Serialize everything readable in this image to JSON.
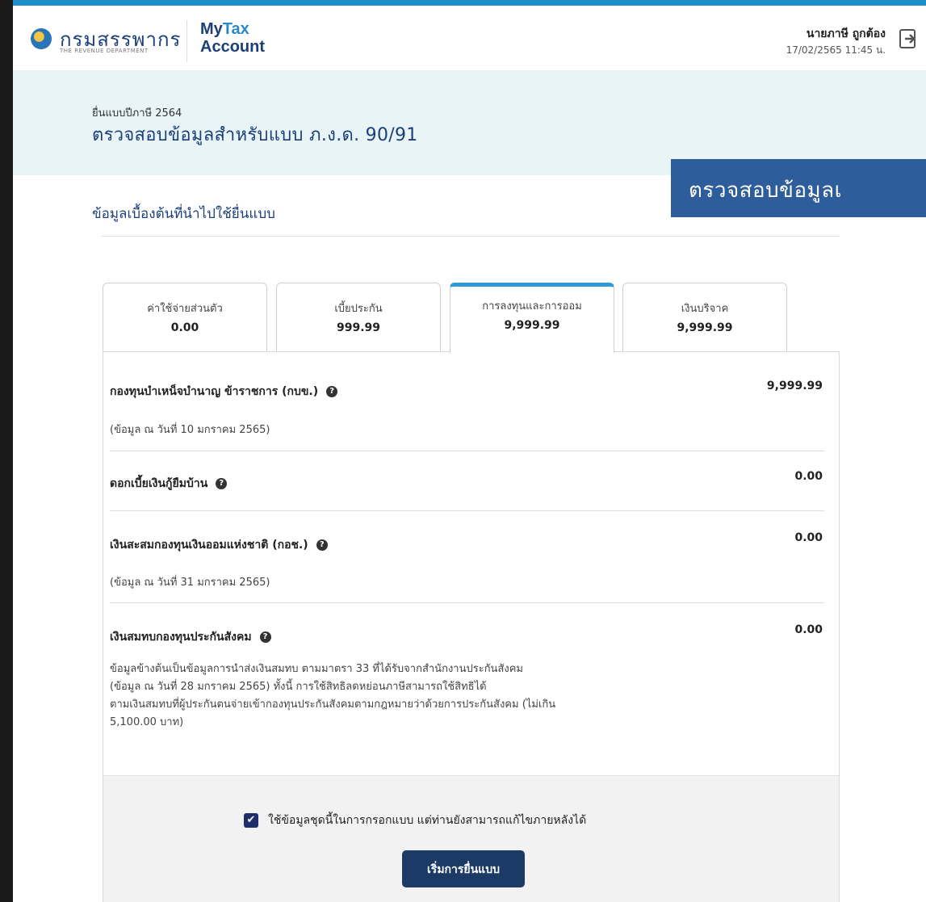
{
  "header": {
    "logo_text": "กรมสรรพากร",
    "logo_subtitle": "THE REVENUE DEPARTMENT",
    "app_name_my": "My",
    "app_name_tax": "Tax",
    "app_name_account": "Account",
    "user_name": "นายภาษี ถูกต้อง",
    "login_time": "17/02/2565  11:45 น."
  },
  "banner": {
    "subtitle": "ยื่นแบบปีภาษี 2564",
    "title": "ตรวจสอบข้อมูลสำหรับแบบ ภ.ง.ด. 90/91"
  },
  "overlay_caption": "ตรวจสอบข้อมูลเ",
  "section_title": "ข้อมูลเบื้องต้นที่นำไปใช้ยื่นแบบ",
  "tabs": [
    {
      "label": "ค่าใช้จ่ายส่วนตัว",
      "value": "0.00"
    },
    {
      "label": "เบี้ยประกัน",
      "value": "999.99"
    },
    {
      "label": "การลงทุนและการออม",
      "value": "9,999.99"
    },
    {
      "label": "เงินบริจาค",
      "value": "9,999.99"
    }
  ],
  "items": [
    {
      "title": "กองทุนบำเหน็จบำนาญ ข้าราชการ (กบข.)",
      "value": "9,999.99",
      "note": "(ข้อมูล ณ วันที่ 10 มกราคม 2565)"
    },
    {
      "title": "ดอกเบี้ยเงินกู้ยืมบ้าน",
      "value": "0.00"
    },
    {
      "title": "เงินสะสมกองทุนเงินออมแห่งชาติ (กอช.)",
      "value": "0.00",
      "note": "(ข้อมูล ณ วันที่ 31 มกราคม 2565)"
    },
    {
      "title": "เงินสมทบกองทุนประกันสังคม",
      "value": "0.00",
      "note_lines": [
        "ข้อมูลข้างต้นเป็นข้อมูลการนำส่งเงินสมทบ ตามมาตรา 33 ที่ได้รับจากสำนักงานประกันสังคม",
        "(ข้อมูล ณ วันที่ 28 มกราคม 2565) ทั้งนี้ การใช้สิทธิลดหย่อนภาษีสามารถใช้สิทธิได้",
        "ตามเงินสมทบที่ผู้ประกันตนจ่ายเข้ากองทุนประกันสังคมตามกฎหมายว่าด้วยการประกันสังคม (ไม่เกิน",
        "5,100.00 บาท)"
      ]
    }
  ],
  "footer": {
    "consent_text": "ใช้ข้อมูลชุดนี้ในการกรอกแบบ แต่ท่านยังสามารถแก้ไขภายหลังได้",
    "consent_checked": true,
    "start_button": "เริ่มการยื่นแบบ"
  },
  "colors": {
    "brand_navy": "#1c3f7a",
    "accent_blue": "#2a9ad9",
    "banner_bg": "#e8f4f6",
    "overlay_bg": "#2d5d9a",
    "button_bg": "#1c3a66"
  },
  "icons": [
    "revenue-department-logo-icon",
    "logout-icon",
    "help-icon",
    "checkbox-checked-icon"
  ]
}
